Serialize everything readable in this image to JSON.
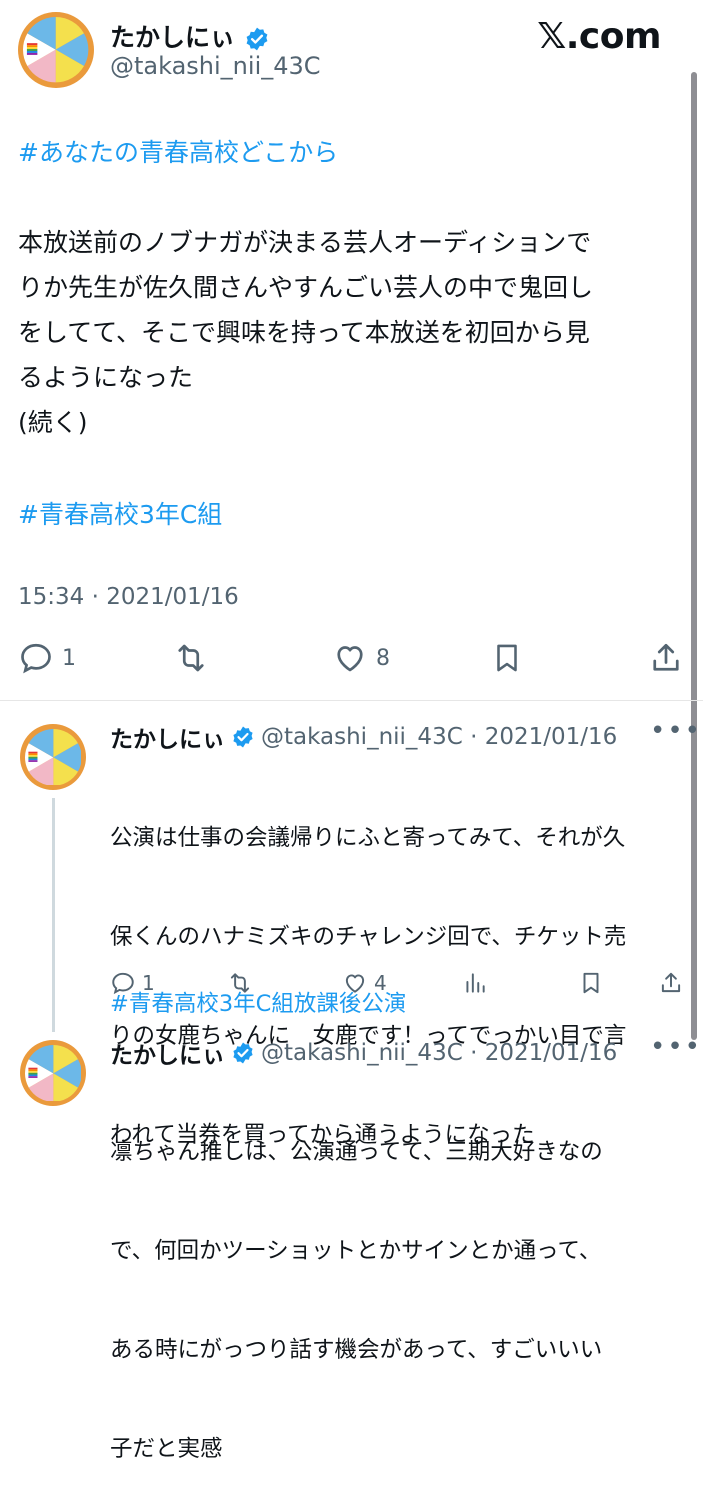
{
  "tweet": {
    "author_name": "たかしにぃ",
    "author_handle": "@takashi_nii_43C",
    "site_logo": "𝕏.com",
    "hashtag_top": "#あなたの青春高校どこから",
    "body_lines": [
      "本放送前のノブナガが決まる芸人オーディションで",
      "りか先生が佐久間さんやすんごい芸人の中で鬼回し",
      "をしてて、そこで興味を持って本放送を初回から見",
      "るようになった",
      "(続く)"
    ],
    "hashtag_bottom": "#青春高校3年C組",
    "timestamp": "15:34 · 2021/01/16",
    "reply_count": "1",
    "like_count": "8"
  },
  "replies": [
    {
      "author_name": "たかしにぃ",
      "meta": "@takashi_nii_43C · 2021/01/16",
      "text_lines": [
        "公演は仕事の会議帰りにふと寄ってみて、それが久",
        "保くんのハナミズキのチャレンジ回で、チケット売",
        "りの女鹿ちゃんに　女鹿です！ってでっかい目で言",
        "われて当券を買ってから通うようになった"
      ],
      "hashtag": "#青春高校3年C組放課後公演",
      "reply_count": "1",
      "like_count": "4"
    },
    {
      "author_name": "たかしにぃ",
      "meta": "@takashi_nii_43C · 2021/01/16",
      "text_lines": [
        "凛ちゃん推しは、公演通ってて、三期大好きなの",
        "で、何回かツーショットとかサインとか通って、",
        "ある時にがっつり話す機会があって、すごいいい",
        "子だと実感"
      ]
    }
  ],
  "icons": {
    "verified": "verified-badge-icon",
    "reply": "reply-icon",
    "retweet": "retweet-icon",
    "like": "heart-icon",
    "bookmark": "bookmark-icon",
    "share": "share-icon",
    "views": "views-icon",
    "more": "more-icon"
  },
  "colors": {
    "accent": "#1d9bf0",
    "muted": "#536471",
    "avatar_ring": "#ea9a3c"
  }
}
